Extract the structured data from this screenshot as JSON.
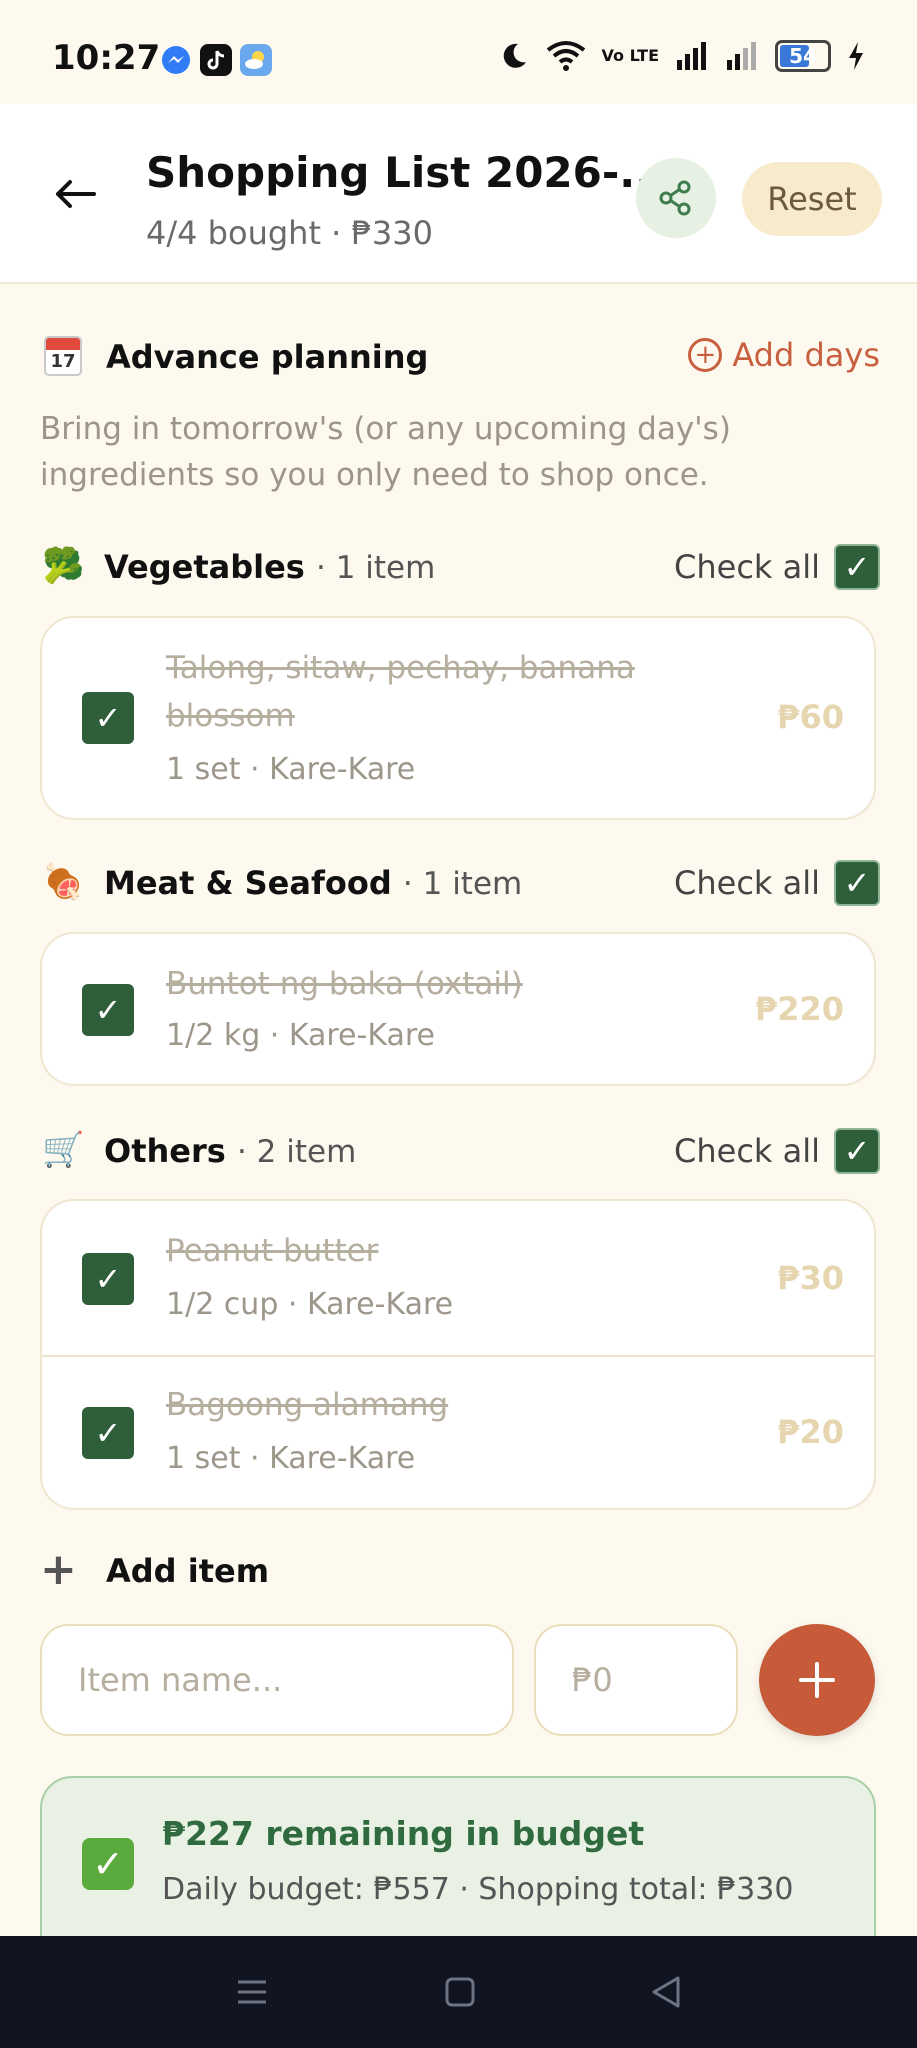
{
  "status_bar": {
    "time": "10:27",
    "battery": "54",
    "volte": "Vo LTE"
  },
  "header": {
    "title": "Shopping List 2026-...",
    "subtitle": "4/4 bought · ₱330",
    "reset_label": "Reset"
  },
  "advance": {
    "calendar_day": "17",
    "title": "Advance planning",
    "add_days_label": "Add days",
    "description": "Bring in tomorrow's (or any upcoming day's) ingredients so you only need to shop once."
  },
  "categories": [
    {
      "emoji": "🥦",
      "title": "Vegetables",
      "count": "· 1 item",
      "check_all_label": "Check all",
      "items": [
        {
          "name": "Talong, sitaw, pechay, banana blossom",
          "meta": "1 set · Kare-Kare",
          "price": "₱60",
          "checked": true
        }
      ]
    },
    {
      "emoji": "🍖",
      "title": "Meat & Seafood",
      "count": "· 1 item",
      "check_all_label": "Check all",
      "items": [
        {
          "name": "Buntot ng baka (oxtail)",
          "meta": "1/2 kg · Kare-Kare",
          "price": "₱220",
          "checked": true
        }
      ]
    },
    {
      "emoji": "🛒",
      "title": "Others",
      "count": "· 2 item",
      "check_all_label": "Check all",
      "items": [
        {
          "name": "Peanut butter",
          "meta": "1/2 cup · Kare-Kare",
          "price": "₱30",
          "checked": true
        },
        {
          "name": "Bagoong alamang",
          "meta": "1 set · Kare-Kare",
          "price": "₱20",
          "checked": true
        }
      ]
    }
  ],
  "add_item": {
    "label": "Add item",
    "name_placeholder": "Item name...",
    "price_placeholder": "₱0"
  },
  "budget": {
    "title": "₱227 remaining in budget",
    "subtitle": "Daily budget: ₱557 · Shopping total: ₱330"
  },
  "colors": {
    "accent": "#c75a39",
    "checkbox": "#2e5e3a",
    "background": "#fdf9ef"
  }
}
